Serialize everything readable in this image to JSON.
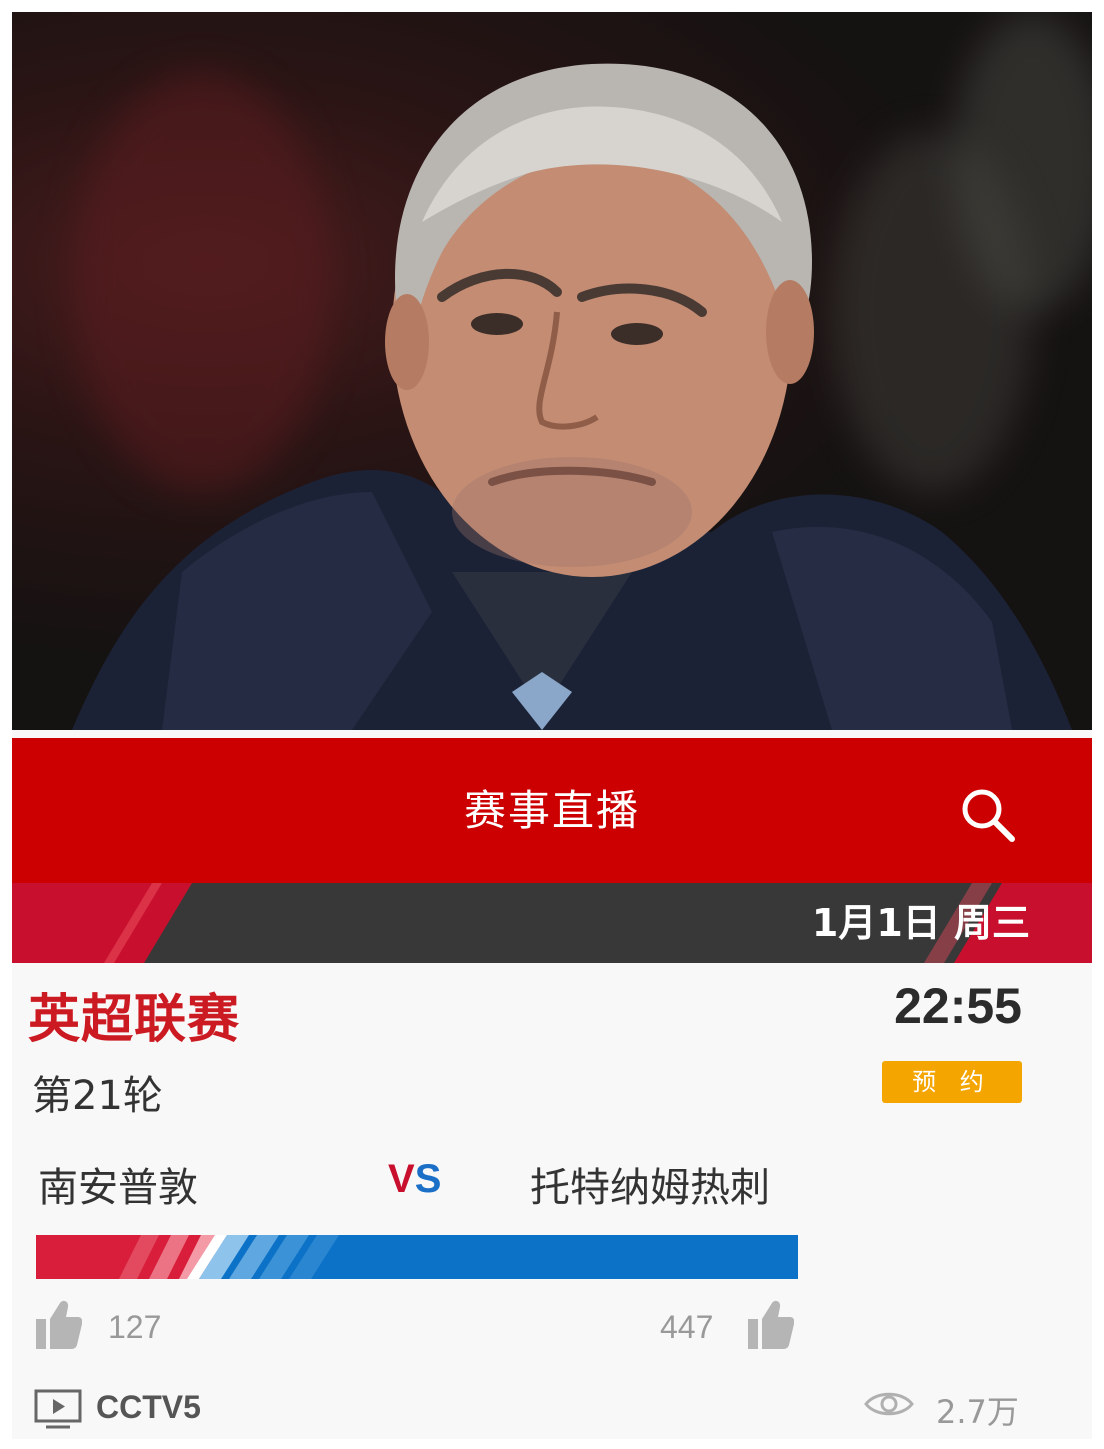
{
  "header": {
    "title": "赛事直播",
    "search_icon": "search-icon"
  },
  "date": {
    "label": "1月1日 周三"
  },
  "match": {
    "league": "英超联赛",
    "time": "22:55",
    "round": "第21轮",
    "reserve_label": "预 约",
    "home_team": "南安普敦",
    "vs_v": "V",
    "vs_s": "S",
    "away_team": "托特纳姆热刺",
    "support": {
      "home": 127,
      "away": 447
    },
    "home_likes": "127",
    "away_likes": "447",
    "channel": "CCTV5",
    "views": "2.7万"
  },
  "colors": {
    "header_red": "#cc0000",
    "league_red": "#cc1a22",
    "home_red": "#d81e3a",
    "away_blue": "#0b72c7",
    "reserve_orange": "#f5a500"
  }
}
